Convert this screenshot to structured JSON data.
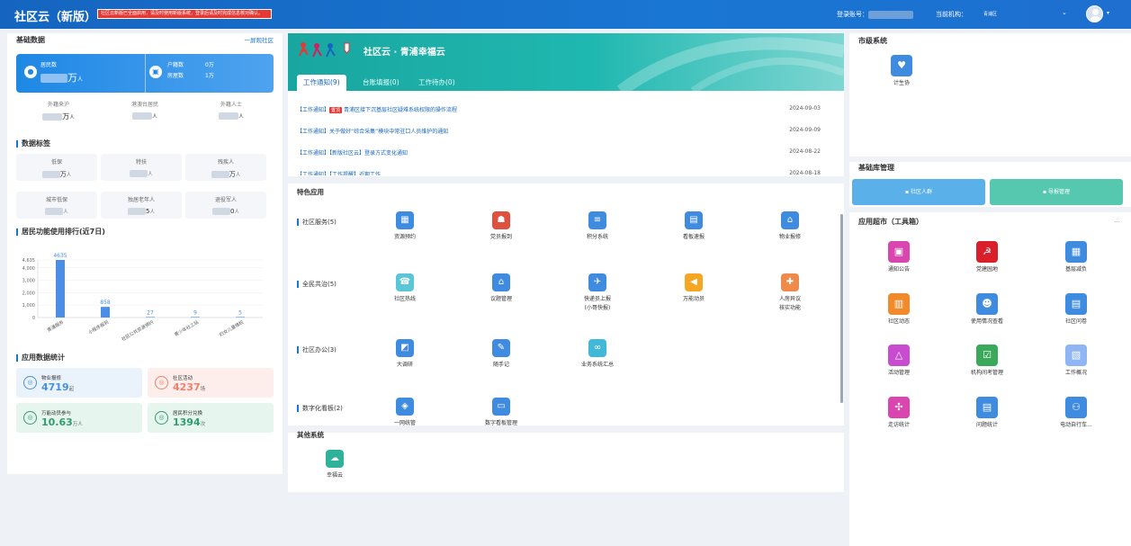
{
  "header": {
    "title": "社区云（新版）",
    "notice": "社区云新版已全面启用，请及时使用新版系统，登录后请及时完成信息核对确认。",
    "login_label": "登录账号：",
    "org_label": "当前机构：",
    "org_value": "青浦区",
    "chevron": "⌄"
  },
  "left": {
    "base_title": "基础数据",
    "switch_link": "一屏观社区",
    "resident_label": "居民数",
    "resident_value": "万",
    "resident_unit": "人",
    "household_label": "户籍数",
    "household_value": "0万",
    "house_label": "房屋数",
    "house_value": "1万",
    "stats_row": [
      {
        "label": "外籍来沪",
        "value": "万",
        "unit": "人"
      },
      {
        "label": "港澳台居民",
        "value": "",
        "unit": "人"
      },
      {
        "label": "外籍人士",
        "value": "",
        "unit": "人"
      }
    ],
    "tag_title": "数据标签",
    "tags": [
      {
        "label": "低保",
        "value": "万",
        "unit": "人"
      },
      {
        "label": "特扶",
        "value": "",
        "unit": "人"
      },
      {
        "label": "残疾人",
        "value": "万",
        "unit": "人"
      },
      {
        "label": "城市低保",
        "value": "",
        "unit": "人"
      },
      {
        "label": "独居老年人",
        "value": "5",
        "unit": "人"
      },
      {
        "label": "退役军人",
        "value": "0",
        "unit": "人"
      }
    ],
    "rank_title": "居民功能使用排行(近7日)",
    "app_title": "应用数据统计",
    "app_stats": [
      {
        "label": "物业报修",
        "value": "4719",
        "unit": "起",
        "color": "#4a90d9",
        "bg": "#eaf3fc",
        "icon": "wrench-icon"
      },
      {
        "label": "社区活动",
        "value": "4237",
        "unit": "场",
        "color": "#f0806b",
        "bg": "#fdeeec",
        "icon": "activity-icon"
      },
      {
        "label": "万能动员参与",
        "value": "10.63",
        "unit": "万人",
        "color": "#2e9e6f",
        "bg": "#e6f5ee",
        "icon": "megaphone-icon"
      },
      {
        "label": "居民积分兑换",
        "value": "1394",
        "unit": "次",
        "color": "#2e9e6f",
        "bg": "#e6f5ee",
        "icon": "exchange-icon"
      }
    ]
  },
  "chart_data": {
    "type": "bar",
    "title": "居民功能使用排行(近7日)",
    "categories": [
      "青浦服务",
      "小程序报到",
      "社区公共资源预约",
      "青少年社工站",
      "妇女儿童维权"
    ],
    "values": [
      4635,
      858,
      27,
      9,
      5
    ],
    "yticks": [
      "0",
      "1,000",
      "2,000",
      "3,000",
      "4,000",
      "4,635"
    ],
    "ylim": [
      0,
      4635
    ],
    "color": "#4a8ee6"
  },
  "center": {
    "banner_title": "社区云 · 青浦幸福云",
    "tabs": [
      {
        "label": "工作通知(9)",
        "active": true
      },
      {
        "label": "台账填报(0)",
        "active": false
      },
      {
        "label": "工作待办(0)",
        "active": false
      }
    ],
    "notices": [
      {
        "prefix": "【工作通知】",
        "tag": "置顶",
        "text": "青浦区接下沉基层社区疑难系统权限的操作流程",
        "date": "2024-09-03"
      },
      {
        "prefix": "【工作通知】",
        "tag": "",
        "text": "关于做好“综合采集”模块中常驻口人员维护的通知",
        "date": "2024-09-09"
      },
      {
        "prefix": "【工作通知】",
        "tag": "",
        "text": "【新版社区云】登录方式变化通知",
        "date": "2024-08-22"
      },
      {
        "prefix": "【工作通知】",
        "tag": "",
        "text": "【工作提醒】近期工作",
        "date": "2024-08-18"
      }
    ],
    "featured_title": "特色应用",
    "groups": [
      {
        "label": "社区服务(5)",
        "apps": [
          {
            "label": "资源预约",
            "color": "#3f8be0",
            "icon": "calendar-icon",
            "glyph": "▦"
          },
          {
            "label": "党员报到",
            "color": "#e0503f",
            "icon": "party-member-icon",
            "glyph": "☗"
          },
          {
            "label": "积分系统",
            "color": "#3f8be0",
            "icon": "database-icon",
            "glyph": "≡"
          },
          {
            "label": "看板速报",
            "color": "#3f8be0",
            "icon": "report-icon",
            "glyph": "▤"
          },
          {
            "label": "物业报修",
            "color": "#3f8be0",
            "icon": "house-icon",
            "glyph": "⌂"
          }
        ]
      },
      {
        "label": "全民共治(5)",
        "apps": [
          {
            "label": "社区热线",
            "color": "#5bc6d8",
            "icon": "hotline-icon",
            "glyph": "☎"
          },
          {
            "label": "议题管理",
            "color": "#3f8be0",
            "icon": "bank-icon",
            "glyph": "⌂"
          },
          {
            "label": "快递员上报",
            "sub": "(小哥快报)",
            "color": "#3f8be0",
            "icon": "courier-icon",
            "glyph": "✈"
          },
          {
            "label": "万能动员",
            "color": "#f5a623",
            "icon": "megaphone-icon",
            "glyph": "◀"
          },
          {
            "label": "人房异议",
            "sub": "核实功能",
            "color": "#f08a4b",
            "icon": "person-house-icon",
            "glyph": "✚"
          }
        ]
      },
      {
        "label": "社区办公(3)",
        "apps": [
          {
            "label": "大调研",
            "color": "#3f8be0",
            "icon": "survey-icon",
            "glyph": "◩"
          },
          {
            "label": "随手记",
            "color": "#3f8be0",
            "icon": "note-icon",
            "glyph": "✎"
          },
          {
            "label": "业务系统汇总",
            "color": "#42b8d8",
            "icon": "link-icon",
            "glyph": "∞"
          }
        ]
      },
      {
        "label": "数字化看板(2)",
        "apps": [
          {
            "label": "一网统管",
            "color": "#3f8be0",
            "icon": "shield-icon",
            "glyph": "◈"
          },
          {
            "label": "数字看板管理",
            "color": "#3f8be0",
            "icon": "monitor-icon",
            "glyph": "▭"
          }
        ]
      }
    ],
    "other_title": "其他系统",
    "other_apps": [
      {
        "label": "幸福云",
        "color": "#2eb39a",
        "icon": "cloud-icon",
        "glyph": "☁"
      }
    ]
  },
  "right": {
    "city_title": "市级系统",
    "city_apps": [
      {
        "label": "计生协",
        "color": "#3f8be0",
        "icon": "family-icon",
        "glyph": "♥"
      }
    ],
    "base_title": "基础库管理",
    "base_buttons": [
      {
        "label": "社区人群",
        "color": "#5ab0e8",
        "icon": "people-icon"
      },
      {
        "label": "导报管理",
        "color": "#56c8b0",
        "icon": "doc-icon"
      }
    ],
    "tools_title": "应用超市（工具箱）",
    "more": "...",
    "tools": [
      {
        "label": "通知公告",
        "color": "#d946b0",
        "icon": "briefcase-icon",
        "glyph": "▣"
      },
      {
        "label": "党建园地",
        "color": "#d9202a",
        "icon": "party-icon",
        "glyph": "☭"
      },
      {
        "label": "基层减负",
        "color": "#3f8be0",
        "icon": "calendar-icon",
        "glyph": "▦"
      },
      {
        "label": "社区动态",
        "color": "#f08a2b",
        "icon": "bar-chart-icon",
        "glyph": "▥"
      },
      {
        "label": "使用情况查看",
        "color": "#3f8be0",
        "icon": "users-icon",
        "glyph": "☻"
      },
      {
        "label": "社区问卷",
        "color": "#3f8be0",
        "icon": "form-icon",
        "glyph": "▤"
      },
      {
        "label": "活动管理",
        "color": "#c84bd0",
        "icon": "recycle-icon",
        "glyph": "△"
      },
      {
        "label": "机构间考管理",
        "color": "#3aaa5a",
        "icon": "check-list-icon",
        "glyph": "☑"
      },
      {
        "label": "工作概况",
        "color": "#8fb5f5",
        "icon": "chart-icon",
        "glyph": "▧"
      },
      {
        "label": "走访统计",
        "color": "#d946b0",
        "icon": "network-icon",
        "glyph": "✣"
      },
      {
        "label": "问题统计",
        "color": "#3f8be0",
        "icon": "document-icon",
        "glyph": "▤"
      },
      {
        "label": "电动自行车...",
        "color": "#3f8be0",
        "icon": "scooter-icon",
        "glyph": "⚇"
      }
    ]
  }
}
